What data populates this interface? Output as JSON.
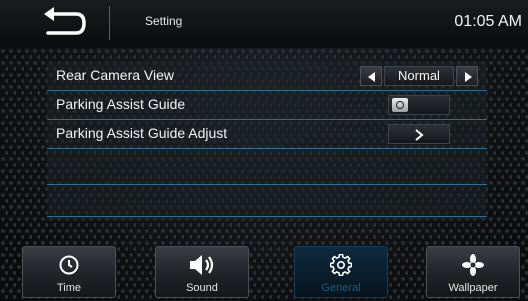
{
  "header": {
    "title": "Setting",
    "clock": "01:05 AM",
    "back_icon": "back-arrow-icon"
  },
  "settings": [
    {
      "label": "Rear Camera View",
      "control": "select",
      "value": "Normal"
    },
    {
      "label": "Parking Assist Guide",
      "control": "toggle",
      "state": "off"
    },
    {
      "label": "Parking Assist Guide Adjust",
      "control": "chevron"
    }
  ],
  "tabs": [
    {
      "label": "Time",
      "icon": "clock-icon",
      "active": false
    },
    {
      "label": "Sound",
      "icon": "speaker-icon",
      "active": false
    },
    {
      "label": "General",
      "icon": "gear-icon",
      "active": true
    },
    {
      "label": "Wallpaper",
      "icon": "wallpaper-icon",
      "active": false
    }
  ],
  "colors": {
    "row_divider": "#2d6f8f",
    "active_tab_label": "#1f5b83",
    "active_tab_bg": "#0a1d2b"
  }
}
